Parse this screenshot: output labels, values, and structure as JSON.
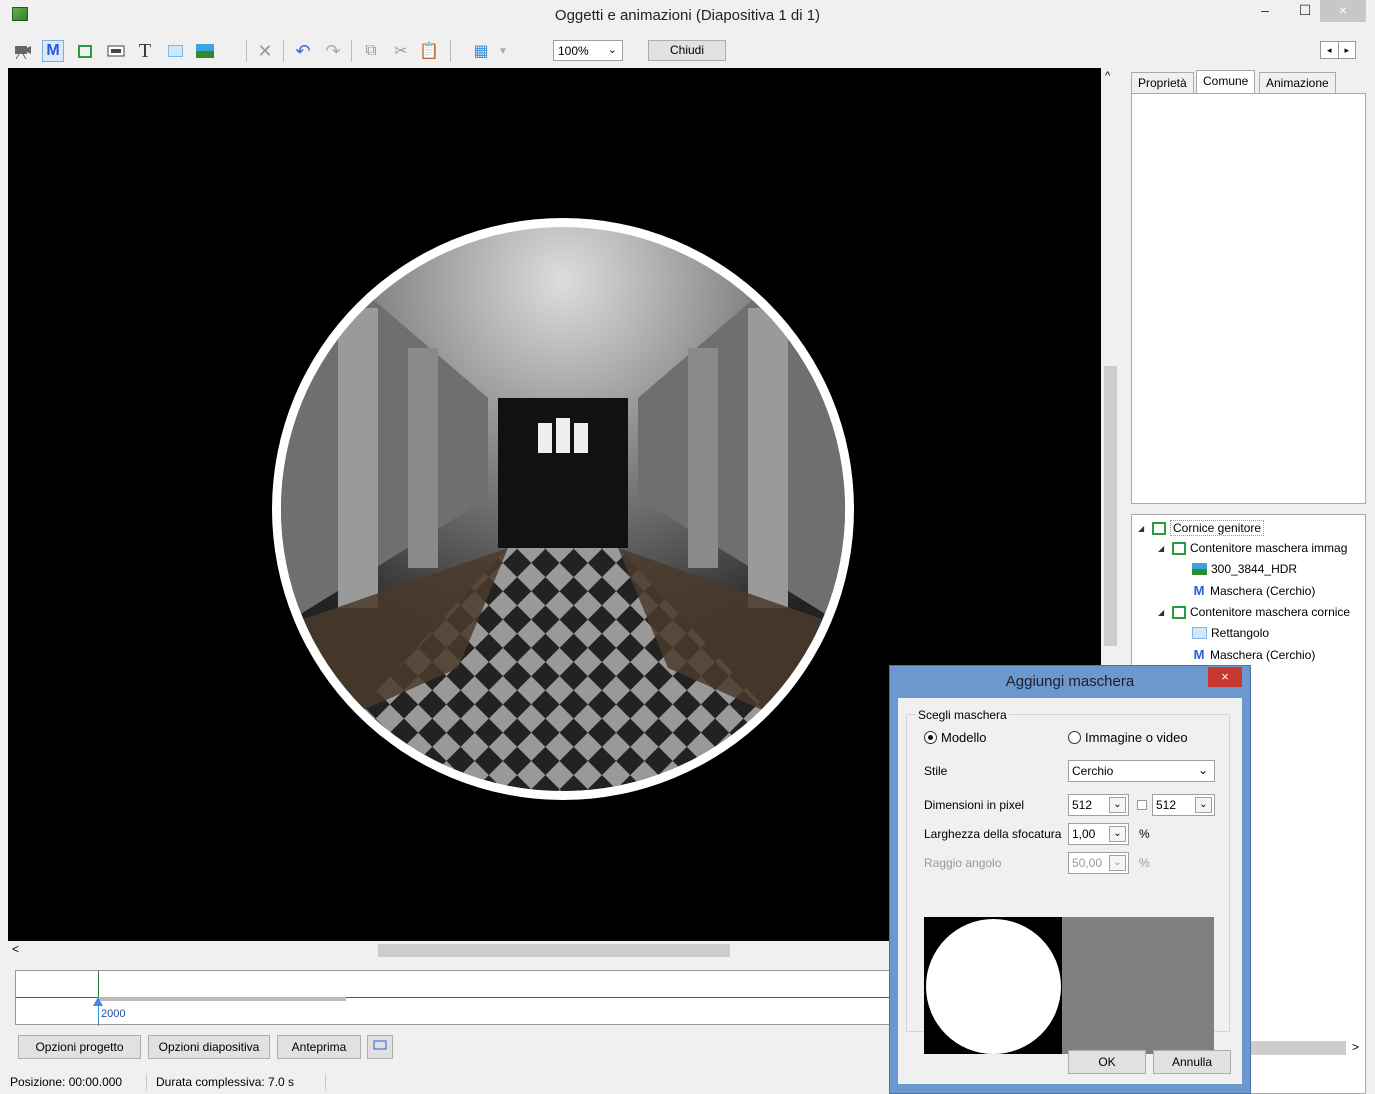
{
  "window": {
    "title": "Oggetti e animazioni  (Diapositiva 1 di 1)",
    "minimize": "–",
    "maximize": "☐",
    "close": "×"
  },
  "toolbar": {
    "zoom": "100%",
    "close_label": "Chiudi",
    "nav_prev": "◂",
    "nav_next": "▸"
  },
  "tabs": [
    "Proprietà",
    "Comune",
    "Animazione"
  ],
  "tree": {
    "items": [
      {
        "label": "Cornice genitore"
      },
      {
        "label": "Contenitore maschera immag"
      },
      {
        "label": "300_3844_HDR"
      },
      {
        "label": "Maschera (Cerchio)"
      },
      {
        "label": "Contenitore maschera cornice"
      },
      {
        "label": "Rettangolo"
      },
      {
        "label": "Maschera (Cerchio)"
      }
    ]
  },
  "timeline": {
    "value": "2000"
  },
  "bottom_buttons": {
    "project_options": "Opzioni progetto",
    "slide_options": "Opzioni diapositiva",
    "preview": "Anteprima"
  },
  "status": {
    "position": "Posizione:  00:00.000",
    "duration": "Durata complessiva:  7.0 s"
  },
  "scroll_left": "<",
  "scroll_right": ">",
  "scroll_up": "^",
  "dialog": {
    "title": "Aggiungi maschera",
    "close": "×",
    "group_label": "Scegli maschera",
    "radio_template": "Modello",
    "radio_image": "Immagine o video",
    "style_label": "Stile",
    "style_value": "Cerchio",
    "dims_label": "Dimensioni in pixel",
    "width": "512",
    "height": "512",
    "blur_label": "Larghezza della sfocatura",
    "blur_value": "1,00",
    "blur_unit": "%",
    "radius_label": "Raggio angolo",
    "radius_value": "50,00",
    "radius_unit": "%",
    "ok": "OK",
    "cancel": "Annulla"
  }
}
